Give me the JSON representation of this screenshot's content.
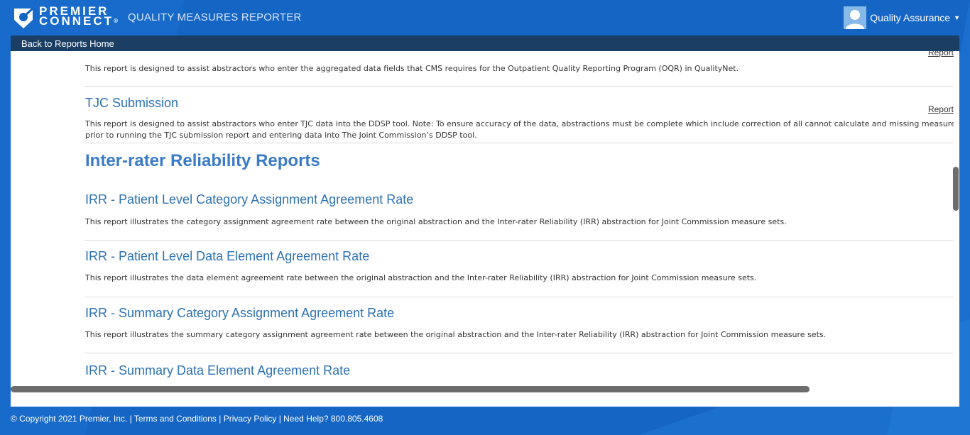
{
  "header": {
    "brand_line1": "PREMIER",
    "brand_line2": "CONNECT",
    "brand_reg": "®",
    "app_title": "QUALITY MEASURES REPORTER",
    "user_name": "Quality Assurance"
  },
  "nav": {
    "back_label": "Back to Reports Home"
  },
  "reports_top": [
    {
      "link": "Report",
      "description": "This report is designed to assist abstractors who enter the aggregated data fields that CMS requires for the Outpatient Quality Reporting Program (OQR) in QualityNet."
    },
    {
      "title": "TJC Submission",
      "link": "Report",
      "description_line1": "This report is designed to assist abstractors who enter TJC data into the DDSP tool. Note: To ensure accuracy of the data, abstractions must be complete which include correction of all cannot calculate and missing measure",
      "description_line2": "prior to running the TJC submission report and entering data into The Joint Commission’s DDSP tool."
    }
  ],
  "section_title": "Inter-rater Reliability Reports",
  "irr_reports": [
    {
      "title": "IRR - Patient Level Category Assignment Agreement Rate",
      "description": "This report illustrates the category assignment agreement rate between the original abstraction and the Inter-rater Reliability (IRR) abstraction for Joint Commission measure sets."
    },
    {
      "title": "IRR - Patient Level Data Element Agreement Rate",
      "description": "This report illustrates the data element agreement rate between the original abstraction and the Inter-rater Reliability (IRR) abstraction for Joint Commission measure sets."
    },
    {
      "title": "IRR - Summary Category Assignment Agreement Rate",
      "description": "This report illustrates the summary category assignment agreement rate between the original abstraction and the Inter-rater Reliability (IRR) abstraction for Joint Commission measure sets."
    },
    {
      "title": "IRR - Summary Data Element Agreement Rate"
    }
  ],
  "footer": {
    "copyright": "© Copyright 2021 Premier, Inc.",
    "sep": " | ",
    "terms": "Terms and Conditions",
    "privacy": "Privacy Policy",
    "help": "Need Help? 800.805.4608"
  },
  "colors": {
    "background_blue": "#1565c4",
    "nav_bar": "#1b3e64",
    "title_blue": "#2c72b2",
    "section_blue": "#3a7bc8"
  },
  "icons": [
    "premier-logo-icon",
    "user-avatar-icon",
    "caret-down-icon"
  ]
}
